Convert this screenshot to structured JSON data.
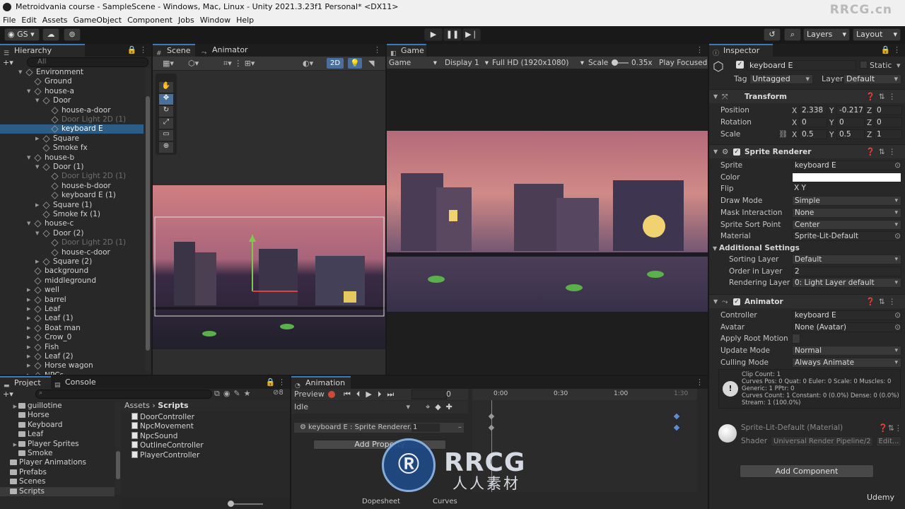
{
  "window": {
    "title": "Metroidvania course - SampleScene - Windows, Mac, Linux - Unity 2021.3.23f1 Personal* <DX11>",
    "watermark_top": "RRCG.cn"
  },
  "menu": [
    "File",
    "Edit",
    "Assets",
    "GameObject",
    "Component",
    "Jobs",
    "Window",
    "Help"
  ],
  "toolbar": {
    "account": "GS",
    "layers": "Layers",
    "layout": "Layout"
  },
  "hierarchy": {
    "tab": "Hierarchy",
    "search_placeholder": "All",
    "items": [
      {
        "label": "Environment",
        "depth": 1,
        "arrow": "▼",
        "state": "normal"
      },
      {
        "label": "Ground",
        "depth": 2,
        "arrow": "",
        "state": "normal"
      },
      {
        "label": "house-a",
        "depth": 2,
        "arrow": "▼",
        "state": "normal"
      },
      {
        "label": "Door",
        "depth": 3,
        "arrow": "▼",
        "state": "normal"
      },
      {
        "label": "house-a-door",
        "depth": 4,
        "arrow": "",
        "state": "normal"
      },
      {
        "label": "Door Light 2D (1)",
        "depth": 4,
        "arrow": "",
        "state": "dim"
      },
      {
        "label": "keyboard E",
        "depth": 4,
        "arrow": "",
        "state": "selected"
      },
      {
        "label": "Square",
        "depth": 3,
        "arrow": "▶",
        "state": "normal"
      },
      {
        "label": "Smoke fx",
        "depth": 3,
        "arrow": "",
        "state": "normal"
      },
      {
        "label": "house-b",
        "depth": 2,
        "arrow": "▼",
        "state": "normal"
      },
      {
        "label": "Door (1)",
        "depth": 3,
        "arrow": "▼",
        "state": "normal"
      },
      {
        "label": "Door Light 2D (1)",
        "depth": 4,
        "arrow": "",
        "state": "dim"
      },
      {
        "label": "house-b-door",
        "depth": 4,
        "arrow": "",
        "state": "normal"
      },
      {
        "label": "keyboard E (1)",
        "depth": 4,
        "arrow": "",
        "state": "normal"
      },
      {
        "label": "Square (1)",
        "depth": 3,
        "arrow": "▶",
        "state": "normal"
      },
      {
        "label": "Smoke fx (1)",
        "depth": 3,
        "arrow": "",
        "state": "normal"
      },
      {
        "label": "house-c",
        "depth": 2,
        "arrow": "▼",
        "state": "normal"
      },
      {
        "label": "Door (2)",
        "depth": 3,
        "arrow": "▼",
        "state": "normal"
      },
      {
        "label": "Door Light 2D (1)",
        "depth": 4,
        "arrow": "",
        "state": "dim"
      },
      {
        "label": "house-c-door",
        "depth": 4,
        "arrow": "",
        "state": "normal"
      },
      {
        "label": "Square (2)",
        "depth": 3,
        "arrow": "▶",
        "state": "normal"
      },
      {
        "label": "background",
        "depth": 2,
        "arrow": "",
        "state": "normal"
      },
      {
        "label": "middleground",
        "depth": 2,
        "arrow": "",
        "state": "normal"
      },
      {
        "label": "well",
        "depth": 2,
        "arrow": "▶",
        "state": "normal"
      },
      {
        "label": "barrel",
        "depth": 2,
        "arrow": "▶",
        "state": "normal"
      },
      {
        "label": "Leaf",
        "depth": 2,
        "arrow": "▶",
        "state": "normal"
      },
      {
        "label": "Leaf (1)",
        "depth": 2,
        "arrow": "▶",
        "state": "normal"
      },
      {
        "label": "Boat man",
        "depth": 2,
        "arrow": "▶",
        "state": "normal"
      },
      {
        "label": "Crow_0",
        "depth": 2,
        "arrow": "▶",
        "state": "normal"
      },
      {
        "label": "Fish",
        "depth": 2,
        "arrow": "▶",
        "state": "normal"
      },
      {
        "label": "Leaf (2)",
        "depth": 2,
        "arrow": "▶",
        "state": "normal"
      },
      {
        "label": "Horse wagon",
        "depth": 2,
        "arrow": "▶",
        "state": "normal"
      },
      {
        "label": "NPCs",
        "depth": 2,
        "arrow": "▶",
        "state": "normal"
      }
    ]
  },
  "scene": {
    "tab_scene": "Scene",
    "tab_animator": "Animator",
    "mode_2d": "2D"
  },
  "game": {
    "tab": "Game",
    "view": "Game",
    "display": "Display 1",
    "resolution": "Full HD (1920x1080)",
    "scale_label": "Scale",
    "scale_value": "0.35x",
    "play_focused": "Play Focused"
  },
  "inspector": {
    "tab": "Inspector",
    "object_name": "keyboard E",
    "static_label": "Static",
    "tag_label": "Tag",
    "tag_value": "Untagged",
    "layer_label": "Layer",
    "layer_value": "Default",
    "transform": {
      "title": "Transform",
      "position": {
        "label": "Position",
        "x": "2.338",
        "y": "-0.217",
        "z": "0"
      },
      "rotation": {
        "label": "Rotation",
        "x": "0",
        "y": "0",
        "z": "0"
      },
      "scale": {
        "label": "Scale",
        "x": "0.5",
        "y": "0.5",
        "z": "1"
      }
    },
    "sprite_renderer": {
      "title": "Sprite Renderer",
      "rows": [
        {
          "k": "Sprite",
          "v": "keyboard E",
          "type": "obj"
        },
        {
          "k": "Color",
          "v": "",
          "type": "color"
        },
        {
          "k": "Flip",
          "v": "X     Y",
          "type": "flip"
        },
        {
          "k": "Draw Mode",
          "v": "Simple",
          "type": "dd"
        },
        {
          "k": "Mask Interaction",
          "v": "None",
          "type": "dd"
        },
        {
          "k": "Sprite Sort Point",
          "v": "Center",
          "type": "dd"
        },
        {
          "k": "Material",
          "v": "Sprite-Lit-Default",
          "type": "obj"
        }
      ],
      "additional": "Additional Settings",
      "rows2": [
        {
          "k": "Sorting Layer",
          "v": "Default",
          "type": "dd"
        },
        {
          "k": "Order in Layer",
          "v": "2",
          "type": "text"
        },
        {
          "k": "Rendering Layer M",
          "v": "0: Light Layer default",
          "type": "dd"
        }
      ]
    },
    "animator": {
      "title": "Animator",
      "rows": [
        {
          "k": "Controller",
          "v": "keyboard E",
          "type": "obj"
        },
        {
          "k": "Avatar",
          "v": "None (Avatar)",
          "type": "obj"
        },
        {
          "k": "Apply Root Motion",
          "v": "",
          "type": "check"
        },
        {
          "k": "Update Mode",
          "v": "Normal",
          "type": "dd"
        },
        {
          "k": "Culling Mode",
          "v": "Always Animate",
          "type": "dd"
        }
      ],
      "info": [
        "Clip Count: 1",
        "Curves Pos: 0 Quat: 0 Euler: 0 Scale: 0 Muscles: 0",
        "Generic: 1 PPtr: 0",
        "Curves Count: 1 Constant: 0 (0.0%) Dense: 0 (0.0%)",
        "Stream: 1 (100.0%)"
      ]
    },
    "material": {
      "name": "Sprite-Lit-Default (Material)",
      "shader_label": "Shader",
      "shader_value": "Universal Render Pipeline/2",
      "edit": "Edit..."
    },
    "add_component": "Add Component"
  },
  "project": {
    "tab_project": "Project",
    "tab_console": "Console",
    "badge": "8",
    "folders": [
      {
        "label": "guillotine",
        "depth": 1,
        "arrow": "▶"
      },
      {
        "label": "Horse",
        "depth": 1,
        "arrow": ""
      },
      {
        "label": "Keyboard",
        "depth": 1,
        "arrow": ""
      },
      {
        "label": "Leaf",
        "depth": 1,
        "arrow": ""
      },
      {
        "label": "Player Sprites",
        "depth": 1,
        "arrow": "▶"
      },
      {
        "label": "Smoke",
        "depth": 1,
        "arrow": ""
      },
      {
        "label": "Player Animations",
        "depth": 0,
        "arrow": ""
      },
      {
        "label": "Prefabs",
        "depth": 0,
        "arrow": ""
      },
      {
        "label": "Scenes",
        "depth": 0,
        "arrow": ""
      },
      {
        "label": "Scripts",
        "depth": 0,
        "arrow": "",
        "selected": true
      }
    ],
    "breadcrumb_root": "Assets",
    "breadcrumb_sep": "›",
    "breadcrumb_current": "Scripts",
    "scripts": [
      "DoorController",
      "NpcMovement",
      "NpcSound",
      "OutlineController",
      "PlayerController"
    ]
  },
  "animation": {
    "tab": "Animation",
    "preview": "Preview",
    "frame": "0",
    "clip": "Idle",
    "property": "keyboard E : Sprite Renderer.",
    "property_value": "1",
    "add_property": "Add Property",
    "dopesheet": "Dopesheet",
    "curves": "Curves",
    "times": [
      "0:00",
      "0:30",
      "1:00",
      "1:30"
    ]
  },
  "watermark": {
    "brand": "RRCG",
    "sub": "人人素材",
    "udemy": "Udemy"
  },
  "colors": {
    "accent": "#3a79bb",
    "selection": "#2c5d87",
    "sky": "#c4707e"
  }
}
